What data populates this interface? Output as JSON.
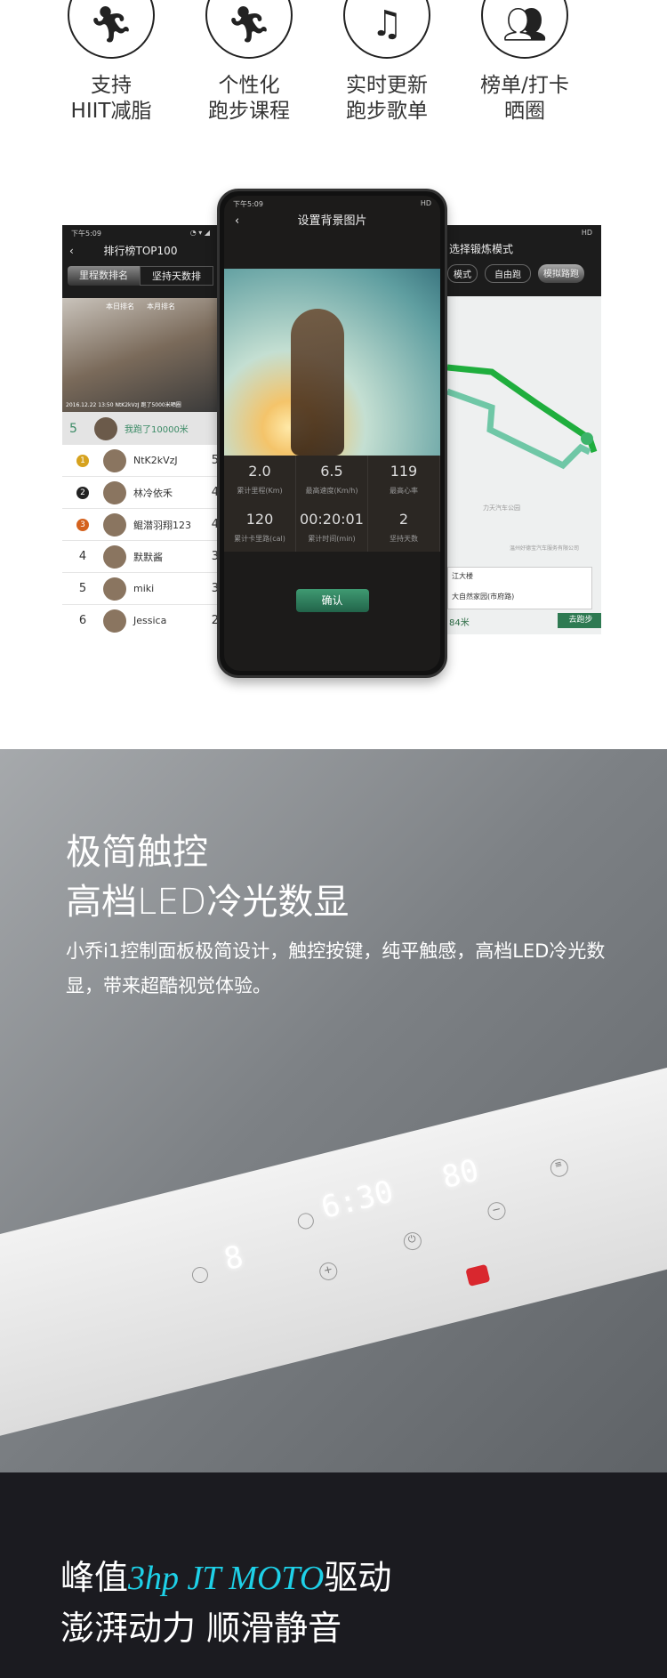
{
  "features": [
    {
      "icon": "running-hiit-icon",
      "lines": [
        "支持",
        "HIIT减脂"
      ]
    },
    {
      "icon": "treadmill-course-icon",
      "lines": [
        "个性化",
        "跑步课程"
      ]
    },
    {
      "icon": "music-note-icon",
      "lines": [
        "实时更新",
        "跑步歌单"
      ]
    },
    {
      "icon": "people-ranking-icon",
      "lines": [
        "榜单/打卡",
        "晒圈"
      ]
    }
  ],
  "phone_left": {
    "time": "下午5:09",
    "title": "排行榜TOP100",
    "tabs": [
      "里程数排名",
      "坚持天数排"
    ],
    "subtabs": [
      "本日排名",
      "本月排名"
    ],
    "caption": "2016.12.22 13:50 NtK2kVzJ 跑了5000米晒圈",
    "me": {
      "rank": "5",
      "text": "我跑了10000米"
    },
    "rows": [
      {
        "rank": "1",
        "name": "NtK2kVzJ",
        "value": "5"
      },
      {
        "rank": "2",
        "name": "林冷依禾",
        "value": "4"
      },
      {
        "rank": "3",
        "name": "鲲潜羽翔123",
        "value": "4"
      },
      {
        "rank": "4",
        "name": "默默酱",
        "value": "3"
      },
      {
        "rank": "5",
        "name": "miki",
        "value": "3"
      },
      {
        "rank": "6",
        "name": "Jessica",
        "value": "2"
      }
    ]
  },
  "phone_center": {
    "time": "下午5:09",
    "status": "HD",
    "title": "设置背景图片",
    "stats": [
      {
        "value": "2.0",
        "label": "累计里程(Km)"
      },
      {
        "value": "6.5",
        "label": "最高速度(Km/h)"
      },
      {
        "value": "119",
        "label": "最高心率"
      },
      {
        "value": "120",
        "label": "累计卡里路(cal)"
      },
      {
        "value": "00:20:01",
        "label": "累计时间(min)"
      },
      {
        "value": "2",
        "label": "坚持天数"
      }
    ],
    "confirm": "确认"
  },
  "phone_right": {
    "status": "HD",
    "title": "选择锻炼模式",
    "modes": [
      "模式",
      "自由跑",
      "模拟路跑"
    ],
    "map_labels": [
      "力天汽车公园",
      "温州好德宝汽车服务有限公司"
    ],
    "from": "江大楼",
    "to": "大自然家园(市府路)",
    "distance": "84米",
    "go": "去跑步"
  },
  "touch": {
    "title1": "极简触控",
    "title2": "高档LED冷光数显",
    "desc": "小乔i1控制面板极简设计，触控按键，纯平触感，高档LED冷光数显，带来超酷视觉体验。",
    "display": {
      "speed": "8",
      "time": "6:30",
      "incline": "80"
    }
  },
  "motor": {
    "pre": "峰值",
    "highlight": "3hp JT MOTO",
    "post": "驱动",
    "line2": "澎湃动力 顺滑静音",
    "highlight_color": "#1ed1e8"
  }
}
